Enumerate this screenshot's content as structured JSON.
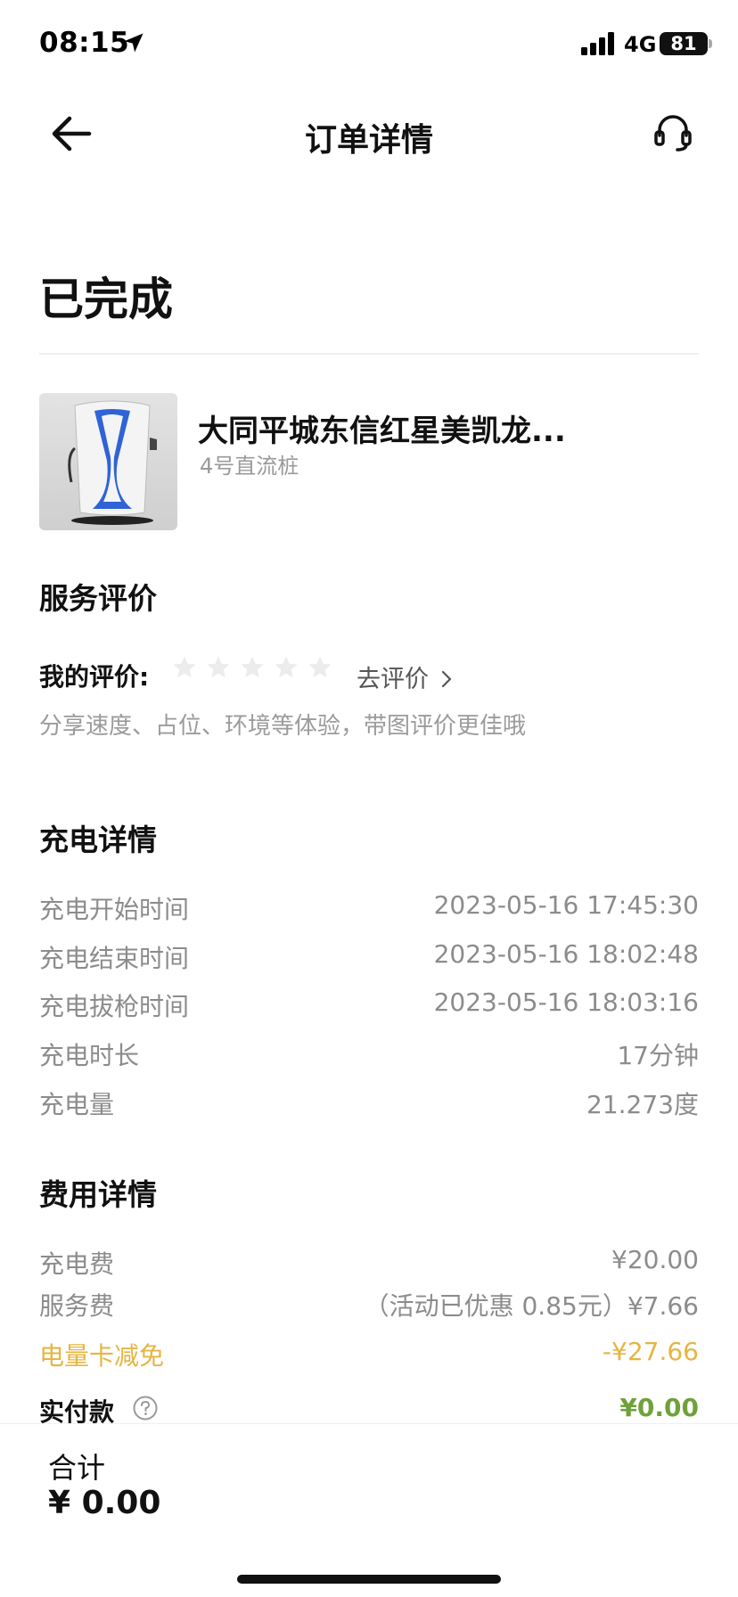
{
  "status_bar": {
    "time": "08:15",
    "network": "4G",
    "battery": "81"
  },
  "nav": {
    "title": "订单详情"
  },
  "order": {
    "status": "已完成"
  },
  "station": {
    "name": "大同平城东信红星美凯龙...",
    "pile": "4号直流桩"
  },
  "review": {
    "section_title": "服务评价",
    "my_rating_label": "我的评价:",
    "stars_total": 5,
    "stars_filled": 0,
    "go_rate_label": "去评价",
    "hint": "分享速度、占位、环境等体验，带图评价更佳哦"
  },
  "charging": {
    "section_title": "充电详情",
    "rows": [
      {
        "label": "充电开始时间",
        "value": "2023-05-16 17:45:30"
      },
      {
        "label": "充电结束时间",
        "value": "2023-05-16 18:02:48"
      },
      {
        "label": "充电拔枪时间",
        "value": "2023-05-16 18:03:16"
      },
      {
        "label": "充电时长",
        "value": "17分钟"
      },
      {
        "label": "充电量",
        "value": "21.273度"
      }
    ]
  },
  "fees": {
    "section_title": "费用详情",
    "charge_fee": {
      "label": "充电费",
      "value": "¥20.00"
    },
    "service_fee": {
      "label": "服务费",
      "value": "（活动已优惠 0.85元）¥7.66"
    },
    "card_discount": {
      "label": "电量卡减免",
      "value": "-¥27.66"
    },
    "paid": {
      "label": "实付款",
      "value": "¥0.00"
    }
  },
  "footer": {
    "total_label": "合计",
    "total_value": "¥ 0.00"
  },
  "colors": {
    "accent_yellow": "#e5b543",
    "paid_green": "#6fa13a",
    "muted_text": "#8c8c8c",
    "charger_blue": "#2f63d6"
  },
  "icons": [
    "location-arrow-icon",
    "signal-icon",
    "back-arrow-icon",
    "headset-icon",
    "star-icon",
    "chevron-right-icon",
    "question-circle-icon"
  ]
}
